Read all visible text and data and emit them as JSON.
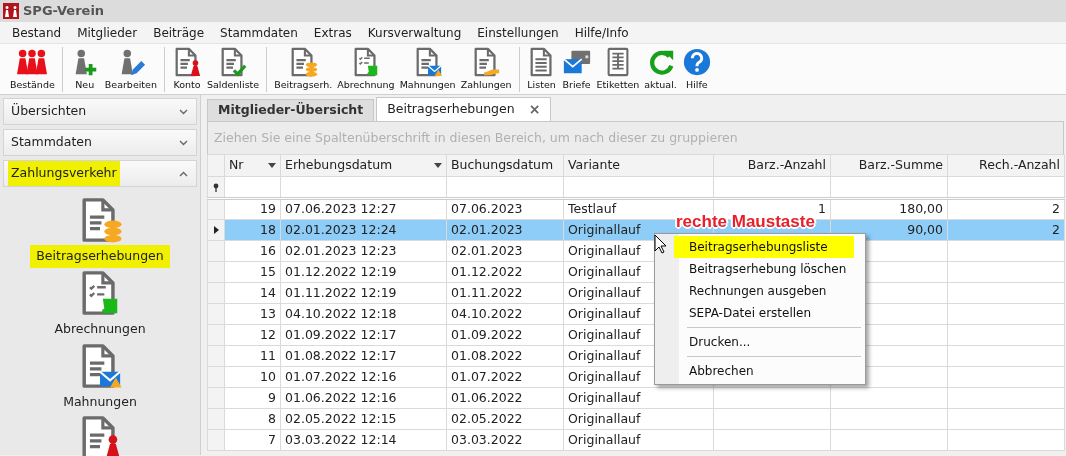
{
  "window": {
    "title": "SPG-Verein"
  },
  "menu": [
    "Bestand",
    "Mitglieder",
    "Beiträge",
    "Stammdaten",
    "Extras",
    "Kursverwaltung",
    "Einstellungen",
    "Hilfe/Info"
  ],
  "toolbar": [
    {
      "buttons": [
        {
          "label": "Bestände",
          "kind": "pawns"
        }
      ]
    },
    {
      "buttons": [
        {
          "label": "Neu",
          "kind": "add"
        },
        {
          "label": "Bearbeiten",
          "kind": "edit"
        }
      ]
    },
    {
      "buttons": [
        {
          "label": "Konto",
          "kind": "account"
        },
        {
          "label": "Saldenliste",
          "kind": "check"
        }
      ]
    },
    {
      "buttons": [
        {
          "label": "Beitragserh.",
          "kind": "coins"
        },
        {
          "label": "Abrechnung",
          "kind": "scroll"
        },
        {
          "label": "Mahnungen",
          "kind": "mail"
        },
        {
          "label": "Zahlungen",
          "kind": "hand"
        }
      ]
    },
    {
      "buttons": [
        {
          "label": "Listen",
          "kind": "list"
        },
        {
          "label": "Briefe",
          "kind": "letters"
        },
        {
          "label": "Etiketten",
          "kind": "labels"
        },
        {
          "label": "aktual.",
          "kind": "refresh"
        },
        {
          "label": "Hilfe",
          "kind": "help"
        }
      ]
    }
  ],
  "sidebar": {
    "groups": [
      {
        "label": "Übersichten",
        "expanded": false,
        "highlighted": false
      },
      {
        "label": "Stammdaten",
        "expanded": false,
        "highlighted": false
      },
      {
        "label": "Zahlungsverkehr",
        "expanded": true,
        "highlighted": true
      }
    ],
    "items": [
      {
        "label": "Beitragserhebungen",
        "kind": "coins",
        "highlighted": true
      },
      {
        "label": "Abrechnungen",
        "kind": "scroll",
        "highlighted": false
      },
      {
        "label": "Mahnungen",
        "kind": "mail",
        "highlighted": false
      },
      {
        "kind": "account"
      }
    ]
  },
  "tabs": [
    {
      "label": "Mitglieder-Übersicht",
      "selected": false
    },
    {
      "label": "Beitragserhebungen",
      "selected": true,
      "close": "×"
    }
  ],
  "group_panel": {
    "hint": "Ziehen Sie eine Spaltenüberschrift in diesen Bereich, um nach dieser zu gruppieren"
  },
  "table": {
    "columns": [
      {
        "label": "Nr",
        "dropdown": true
      },
      {
        "label": "Erhebungsdatum",
        "dropdown": true
      },
      {
        "label": "Buchungsdatum",
        "dropdown": false
      },
      {
        "label": "Variante",
        "dropdown": false
      },
      {
        "label": "Barz.-Anzahl",
        "dropdown": false
      },
      {
        "label": "Barz.-Summe",
        "dropdown": false
      },
      {
        "label": "Rech.-Anzahl",
        "dropdown": false
      }
    ],
    "rows": [
      {
        "cells": [
          "19",
          "07.06.2023 12:27",
          "07.06.2023",
          "Testlauf",
          "1",
          "180,00",
          "2"
        ],
        "selected": false
      },
      {
        "cells": [
          "18",
          "02.01.2023 12:24",
          "02.01.2023",
          "Originallauf",
          "",
          "90,00",
          "2"
        ],
        "selected": true
      },
      {
        "cells": [
          "16",
          "02.01.2023 12:23",
          "02.01.2023",
          "Originallauf",
          "",
          "",
          ""
        ],
        "selected": false
      },
      {
        "cells": [
          "15",
          "01.12.2022 12:19",
          "01.12.2022",
          "Originallauf",
          "",
          "",
          ""
        ],
        "selected": false
      },
      {
        "cells": [
          "14",
          "01.11.2022 12:19",
          "01.11.2022",
          "Originallauf",
          "",
          "",
          ""
        ],
        "selected": false
      },
      {
        "cells": [
          "13",
          "04.10.2022 12:18",
          "04.10.2022",
          "Originallauf",
          "",
          "",
          ""
        ],
        "selected": false
      },
      {
        "cells": [
          "12",
          "01.09.2022 12:17",
          "01.09.2022",
          "Originallauf",
          "",
          "",
          ""
        ],
        "selected": false
      },
      {
        "cells": [
          "11",
          "01.08.2022 12:17",
          "01.08.2022",
          "Originallauf",
          "",
          "",
          ""
        ],
        "selected": false
      },
      {
        "cells": [
          "10",
          "01.07.2022 12:16",
          "01.07.2022",
          "Originallauf",
          "",
          "",
          ""
        ],
        "selected": false
      },
      {
        "cells": [
          "9",
          "01.06.2022 12:16",
          "01.06.2022",
          "Originallauf",
          "",
          "",
          ""
        ],
        "selected": false
      },
      {
        "cells": [
          "8",
          "02.05.2022 12:15",
          "02.05.2022",
          "Originallauf",
          "",
          "",
          ""
        ],
        "selected": false
      },
      {
        "cells": [
          "7",
          "03.03.2022 12:14",
          "03.03.2022",
          "Originallauf",
          "",
          "",
          ""
        ],
        "selected": false
      }
    ]
  },
  "context_menu": {
    "items": [
      {
        "kind": "item",
        "label": "Beitragserhebungsliste",
        "highlighted": true
      },
      {
        "kind": "item",
        "label": "Beitragserhebung löschen",
        "highlighted": false
      },
      {
        "kind": "item",
        "label": "Rechnungen ausgeben",
        "highlighted": false
      },
      {
        "kind": "item",
        "label": "SEPA-Datei erstellen",
        "highlighted": false
      },
      {
        "kind": "separator"
      },
      {
        "kind": "item",
        "label": "Drucken...",
        "highlighted": false
      },
      {
        "kind": "separator"
      },
      {
        "kind": "item",
        "label": "Abbrechen",
        "highlighted": false
      }
    ]
  },
  "annotation": {
    "text": "rechte Maustaste"
  }
}
